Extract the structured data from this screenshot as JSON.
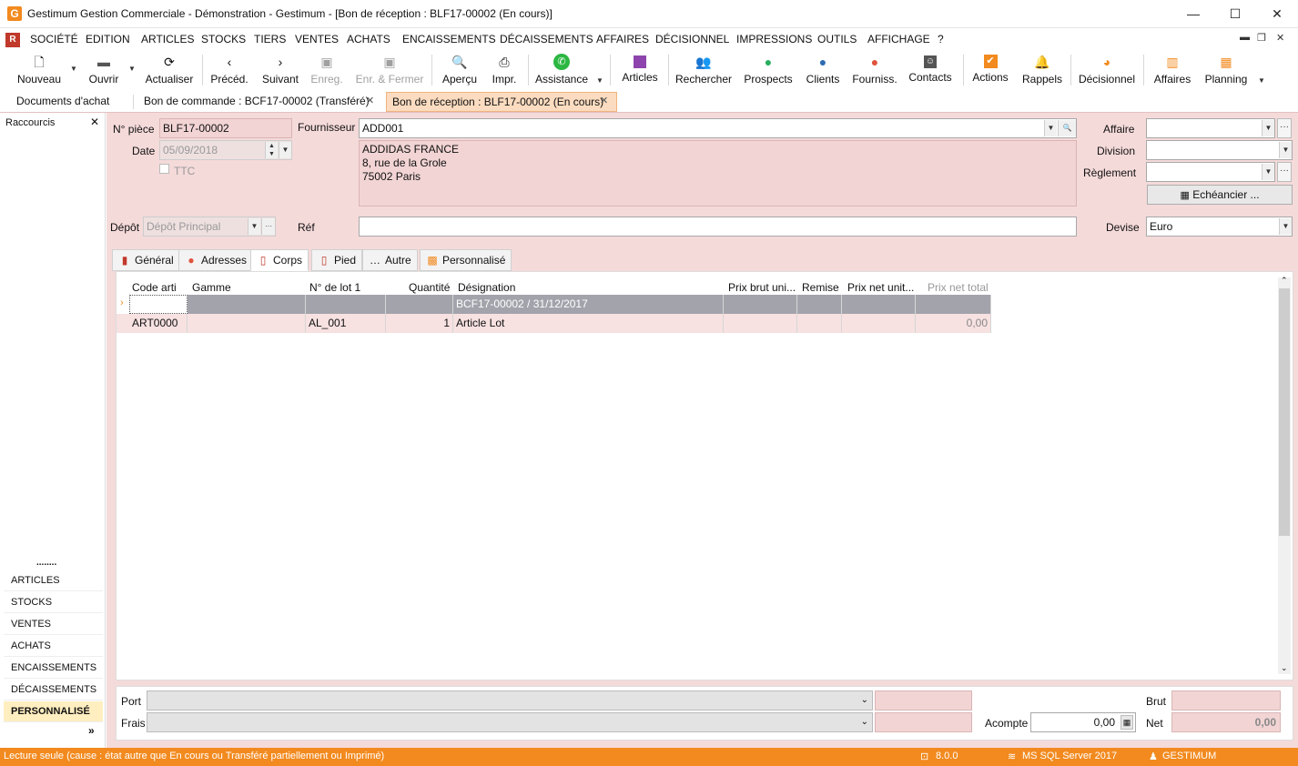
{
  "window": {
    "title": "Gestimum Gestion Commerciale - Démonstration - Gestimum - [Bon de réception : BLF17-00002 (En cours)]",
    "app_icon": "G",
    "minimize": "—",
    "maximize": "☐",
    "close": "✕"
  },
  "menu": [
    "SOCIÉTÉ",
    "EDITION",
    "ARTICLES",
    "STOCKS",
    "TIERS",
    "VENTES",
    "ACHATS",
    "ENCAISSEMENTS",
    "DÉCAISSEMENTS",
    "AFFAIRES",
    "DÉCISIONNEL",
    "IMPRESSIONS",
    "OUTILS",
    "AFFICHAGE",
    "?"
  ],
  "toolbar": {
    "nouveau": "Nouveau",
    "ouvrir": "Ouvrir",
    "actualiser": "Actualiser",
    "preced": "Précéd.",
    "suivant": "Suivant",
    "enreg": "Enreg.",
    "enr_fermer": "Enr. & Fermer",
    "apercu": "Aperçu",
    "impr": "Impr.",
    "assistance": "Assistance",
    "articles": "Articles",
    "rechercher": "Rechercher",
    "prospects": "Prospects",
    "clients": "Clients",
    "fourniss": "Fourniss.",
    "contacts": "Contacts",
    "actions": "Actions",
    "rappels": "Rappels",
    "decisionnel": "Décisionnel",
    "affaires": "Affaires",
    "planning": "Planning"
  },
  "doc_tabs": {
    "t1": "Documents d'achat",
    "t2": "Bon de commande : BCF17-00002 (Transféré)",
    "t3": "Bon de réception : BLF17-00002 (En cours)"
  },
  "left_panel": {
    "header": "Raccourcis",
    "dots": "........",
    "items": [
      "ARTICLES",
      "STOCKS",
      "VENTES",
      "ACHATS",
      "ENCAISSEMENTS",
      "DÉCAISSEMENTS",
      "PERSONNALISÉ"
    ],
    "more": "»"
  },
  "form": {
    "npiece_label": "N° pièce",
    "npiece_value": "BLF17-00002",
    "date_label": "Date",
    "date_value": "05/09/2018",
    "ttc_label": "TTC",
    "fournisseur_label": "Fournisseur",
    "fournisseur_value": "ADD001",
    "address_line1": "ADDIDAS FRANCE",
    "address_line2": "8, rue de la Grole",
    "address_line3": "75002 Paris",
    "affaire_label": "Affaire",
    "division_label": "Division",
    "reglement_label": "Règlement",
    "echeancier_label": "Echéancier ...",
    "depot_label": "Dépôt",
    "depot_value": "Dépôt Principal",
    "ref_label": "Réf",
    "devise_label": "Devise",
    "devise_value": "Euro"
  },
  "inner_tabs": [
    "Général",
    "Adresses",
    "Corps",
    "Pied",
    "Autre",
    "Personnalisé"
  ],
  "grid": {
    "columns": [
      "Code arti",
      "Gamme",
      "N° de lot 1",
      "Quantité",
      "Désignation",
      "Prix brut uni...",
      "Remise",
      "Prix net unit...",
      "Prix net total"
    ],
    "rows": [
      {
        "code": "",
        "gamme": "",
        "lot": "",
        "qte": "",
        "designation": "BCF17-00002 / 31/12/2017",
        "pbrut": "",
        "remise": "",
        "pnet": "",
        "ptotal": ""
      },
      {
        "code": "ART0000",
        "gamme": "",
        "lot": "AL_001",
        "qte": "1",
        "designation": "Article Lot",
        "pbrut": "",
        "remise": "",
        "pnet": "",
        "ptotal": "0,00"
      }
    ]
  },
  "footer": {
    "port_label": "Port",
    "frais_label": "Frais",
    "acompte_label": "Acompte",
    "acompte_value": "0,00",
    "brut_label": "Brut",
    "net_label": "Net",
    "net_value": "0,00"
  },
  "status": {
    "message": "Lecture seule (cause : état autre que En cours ou Transféré partiellement ou Imprimé)",
    "version": "8.0.0",
    "db": "MS SQL Server 2017",
    "user": "GESTIMUM"
  },
  "colors": {
    "accent": "#f28a1f",
    "form_bg": "#f5dada",
    "active_tab": "#fbdcc0"
  }
}
